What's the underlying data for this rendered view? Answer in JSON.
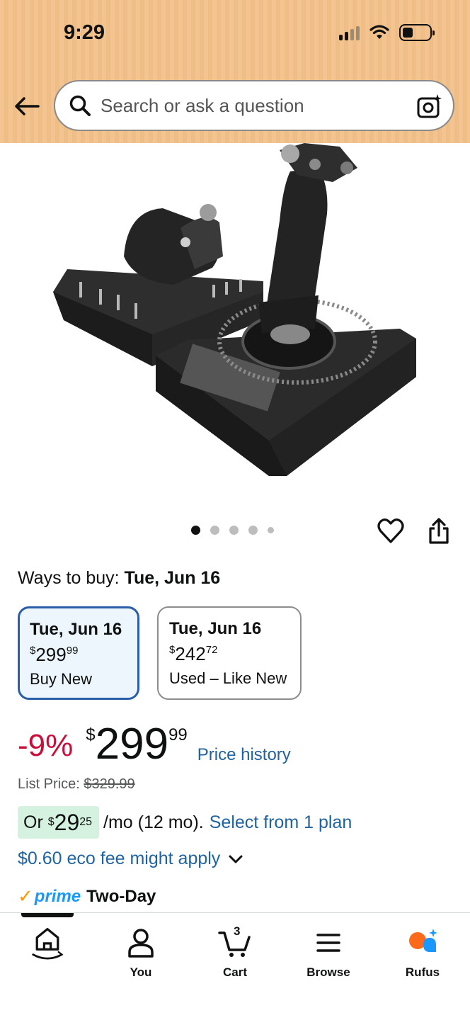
{
  "status_bar": {
    "time": "9:29"
  },
  "search": {
    "placeholder": "Search or ask a question"
  },
  "image_carousel": {
    "dot_count": 5,
    "active_index": 0
  },
  "ways_to_buy": {
    "label": "Ways to buy:",
    "date": "Tue, Jun 16",
    "options": [
      {
        "date": "Tue, Jun 16",
        "currency": "$",
        "price_whole": "299",
        "price_fraction": "99",
        "condition": "Buy New",
        "selected": true
      },
      {
        "date": "Tue, Jun 16",
        "currency": "$",
        "price_whole": "242",
        "price_fraction": "72",
        "condition": "Used – Like New",
        "selected": false
      }
    ]
  },
  "price": {
    "discount": "-9%",
    "currency": "$",
    "whole": "299",
    "fraction": "99",
    "history_link": "Price history",
    "list_price_label": "List Price:",
    "list_price": "$329.99"
  },
  "installment": {
    "prefix": "Or",
    "currency": "$",
    "whole": "29",
    "fraction": "25",
    "rest": "/mo (12 mo).",
    "link": "Select from 1 plan"
  },
  "eco_fee": {
    "text": "$0.60 eco fee might apply"
  },
  "prime": {
    "word": "prime",
    "delivery": "Two-Day"
  },
  "bottom_nav": {
    "items": [
      {
        "label": "",
        "icon": "home-icon"
      },
      {
        "label": "You",
        "icon": "user-icon"
      },
      {
        "label": "Cart",
        "icon": "cart-icon",
        "count": "3"
      },
      {
        "label": "Browse",
        "icon": "menu-icon"
      },
      {
        "label": "Rufus",
        "icon": "rufus-icon"
      }
    ]
  },
  "colors": {
    "header_bg": "#f3c48f",
    "discount_red": "#cc0c39",
    "link_blue": "#2162a1",
    "selected_border": "#2a5ea8",
    "installment_bg": "#d5f2e1",
    "prime_blue": "#1a98ff",
    "prime_check": "#ff9900"
  }
}
